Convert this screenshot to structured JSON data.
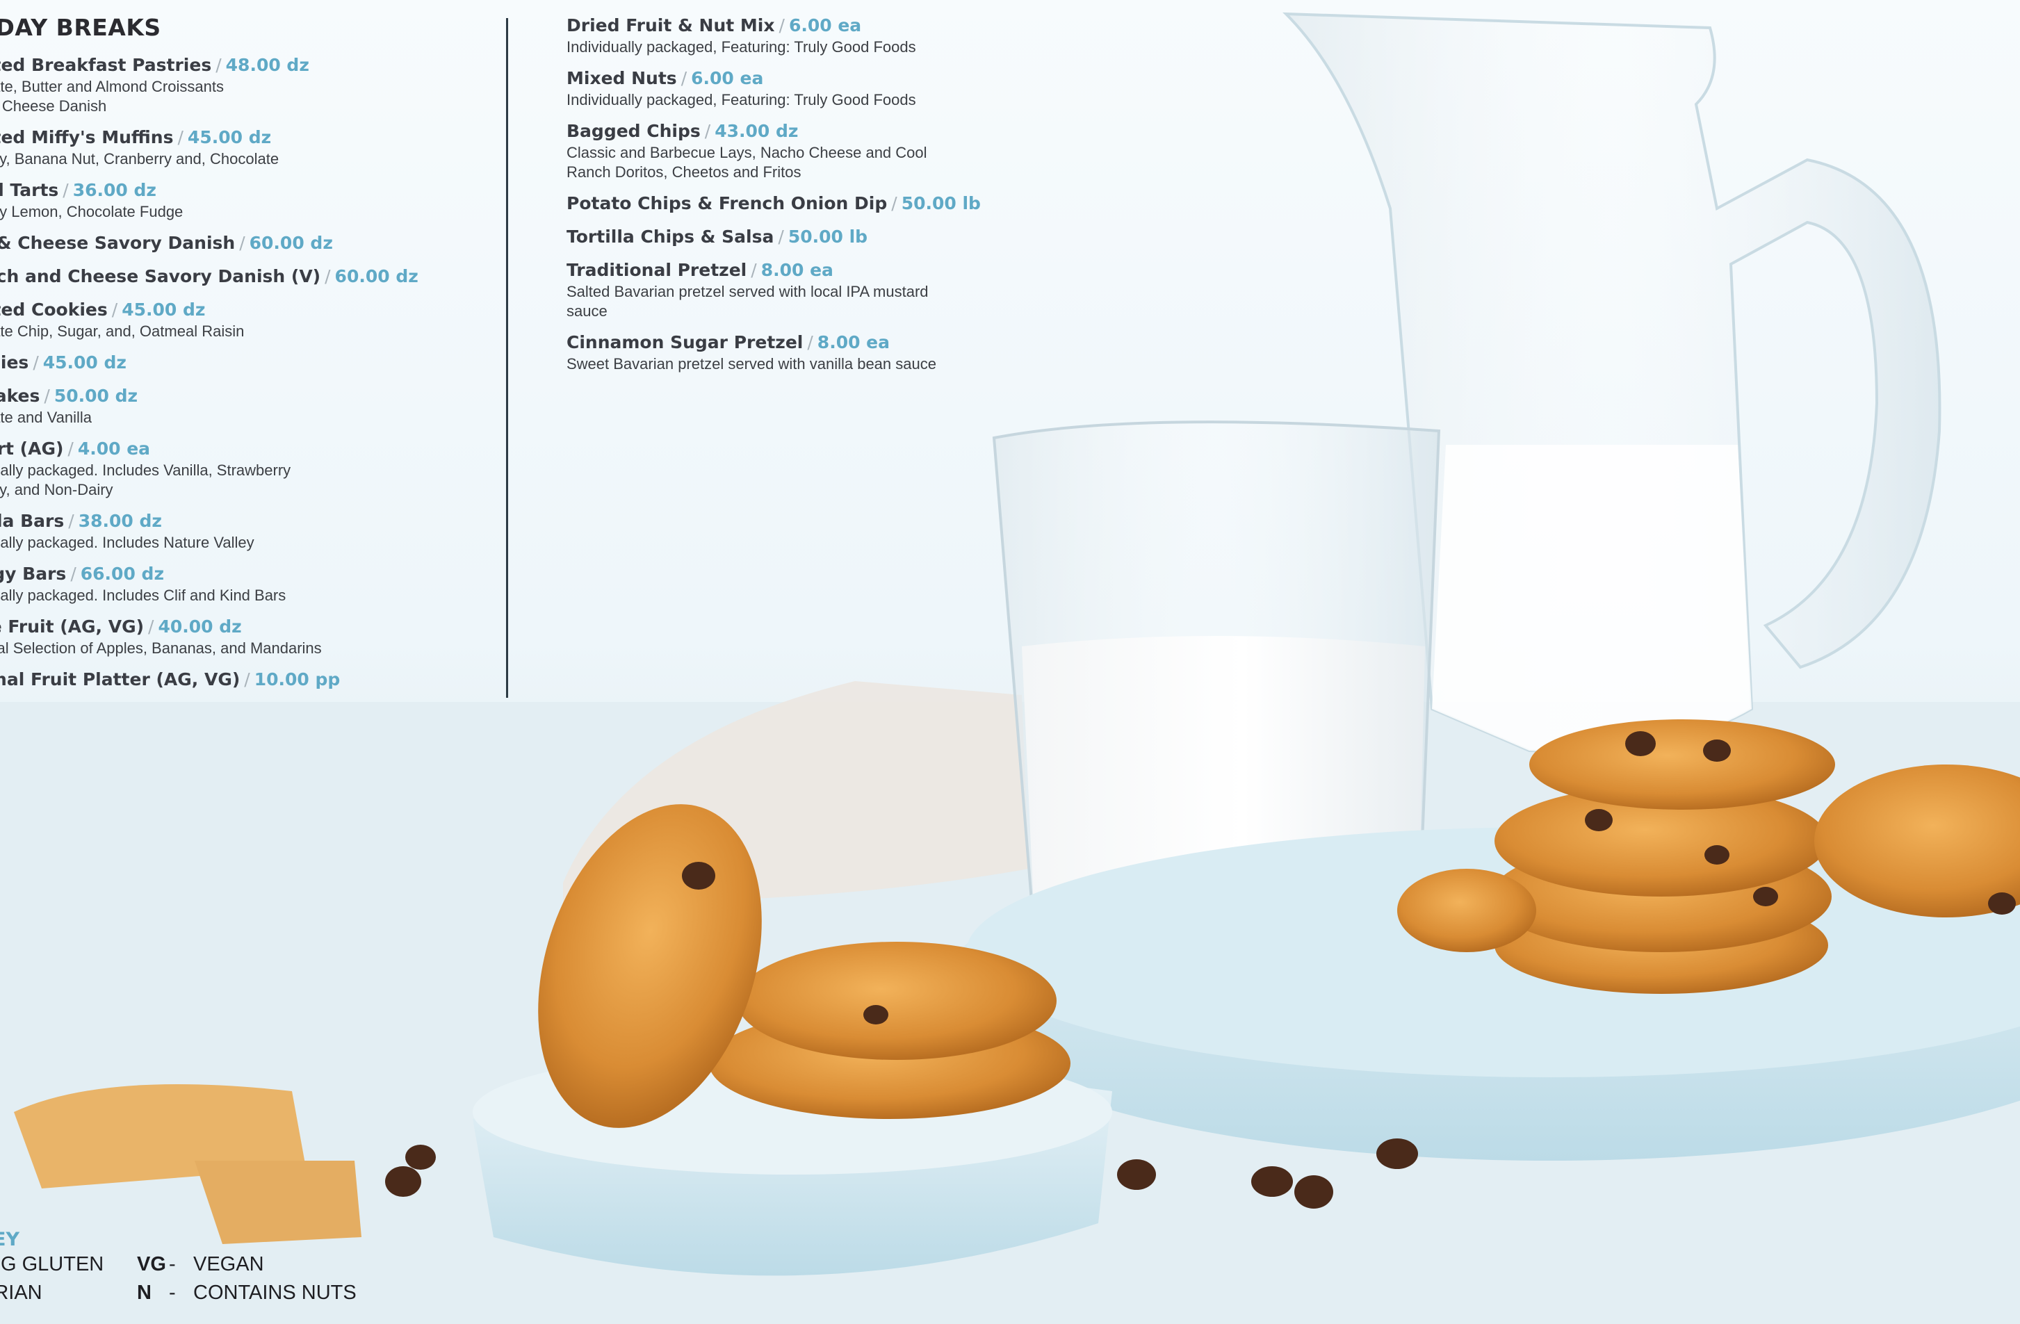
{
  "left_column": {
    "title": "L DAY BREAKS",
    "items": [
      {
        "name": "orted Breakfast Pastries",
        "price": "48.00 dz",
        "desc": [
          "colate, Butter and Almond Croissants",
          "and Cheese Danish"
        ]
      },
      {
        "name": "orted Miffy's Muffins",
        "price": "45.00 dz",
        "desc": [
          "berry, Banana Nut, Cranberry and, Chocolate"
        ]
      },
      {
        "name": "fed Tarts",
        "price": "36.00 dz",
        "desc": [
          "berry Lemon, Chocolate Fudge"
        ]
      },
      {
        "name": "m & Cheese Savory Danish",
        "price": "60.00 dz",
        "desc": []
      },
      {
        "name": "nach and Cheese Savory Danish  (V)",
        "price": "60.00 dz",
        "desc": []
      },
      {
        "name": "orted Cookies",
        "price": "45.00 dz",
        "desc": [
          "colate Chip, Sugar, and, Oatmeal Raisin"
        ]
      },
      {
        "name": "wnies",
        "price": "45.00 dz",
        "desc": []
      },
      {
        "name": "pcakes",
        "price": "50.00 dz",
        "desc": [
          "colate and Vanilla"
        ]
      },
      {
        "name": "gurt (AG)",
        "price": "4.00 ea",
        "desc": [
          "vidually packaged. Includes Vanilla, Strawberry",
          "berry, and Non-Dairy"
        ]
      },
      {
        "name": "nola Bars",
        "price": "38.00 dz",
        "desc": [
          "vidually packaged. Includes Nature Valley"
        ]
      },
      {
        "name": "ergy Bars",
        "price": "66.00 dz",
        "desc": [
          "vidually packaged. Includes Clif and Kind Bars"
        ]
      },
      {
        "name": "ole Fruit (AG, VG)",
        "price": "40.00 dz",
        "desc": [
          "sonal Selection of Apples, Bananas, and Mandarins"
        ]
      },
      {
        "name": "sonal Fruit Platter  (AG, VG)",
        "price": "10.00 pp",
        "desc": []
      }
    ]
  },
  "right_column": {
    "items": [
      {
        "name": "Dried Fruit & Nut Mix",
        "price": "6.00 ea",
        "desc": [
          "Individually packaged, Featuring: Truly Good Foods"
        ]
      },
      {
        "name": "Mixed Nuts",
        "price": "6.00 ea",
        "desc": [
          "Individually packaged, Featuring: Truly Good Foods"
        ]
      },
      {
        "name": "Bagged Chips",
        "price": "43.00 dz",
        "desc": [
          "Classic and Barbecue Lays, Nacho Cheese and Cool",
          "Ranch Doritos, Cheetos and Fritos"
        ]
      },
      {
        "name": "Potato Chips & French Onion Dip",
        "price": "50.00 lb",
        "desc": []
      },
      {
        "name": "Tortilla Chips & Salsa",
        "price": "50.00 lb",
        "desc": []
      },
      {
        "name": "Traditional Pretzel",
        "price": "8.00 ea",
        "desc": [
          "Salted Bavarian pretzel served with local IPA mustard",
          "sauce"
        ]
      },
      {
        "name": "Cinnamon Sugar Pretzel",
        "price": "8.00 ea",
        "desc": [
          "Sweet Bavarian pretzel served with vanilla bean sauce"
        ]
      }
    ]
  },
  "separator": "/",
  "key": {
    "title": "EY",
    "rows": [
      {
        "left": "ING GLUTEN",
        "code": "VG",
        "dash": "-",
        "definition": "VEGAN"
      },
      {
        "left": "ARIAN",
        "code": "N",
        "dash": "-",
        "definition": "CONTAINS NUTS"
      }
    ]
  },
  "colors": {
    "price": "#5fa9c6",
    "heading": "#2b2b30",
    "text": "#3c3f44",
    "divider": "#2d3b45"
  }
}
